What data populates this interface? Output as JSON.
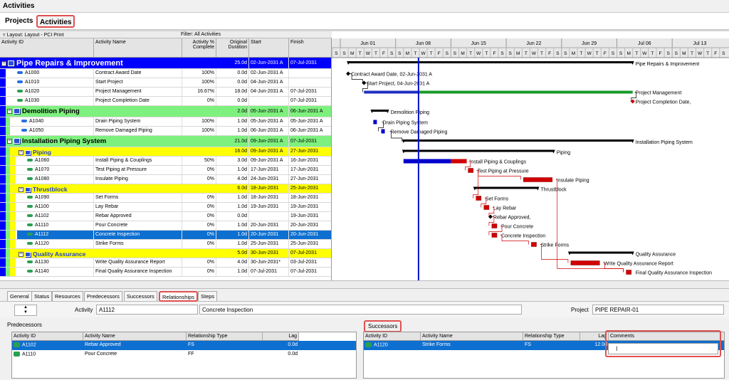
{
  "window_title": "Activities",
  "top_tabs": [
    {
      "label": "Projects"
    },
    {
      "label": "Activities"
    }
  ],
  "filter_bar": {
    "layout": "Layout: Layout - PCI Print",
    "filter": "Filter: All Activities"
  },
  "columns": [
    "Activity ID",
    "Activity Name",
    "Activity % Complete",
    "Original Duration",
    "Start",
    "Finish"
  ],
  "rows": [
    {
      "kind": "wbs1",
      "id": "",
      "name": "Pipe Repairs & Improvement",
      "pct": "",
      "dur": "25.0d",
      "start": "02-Jun-2031 A",
      "finish": "07-Jul-2031",
      "color": "#0000ff",
      "text_color": "#ffffff"
    },
    {
      "kind": "act",
      "id": "A1000",
      "name": "Contract Award Date",
      "pct": "100%",
      "dur": "0.0d",
      "start": "02-Jun-2031 A",
      "finish": "",
      "icon": "#2a6fe0"
    },
    {
      "kind": "act",
      "id": "A1010",
      "name": "Start Project",
      "pct": "100%",
      "dur": "0.0d",
      "start": "04-Jun-2031 A",
      "finish": "",
      "icon": "#2a6fe0"
    },
    {
      "kind": "act",
      "id": "A1020",
      "name": "Project Management",
      "pct": "16.67%",
      "dur": "18.0d",
      "start": "04-Jun-2031 A",
      "finish": "07-Jul-2031",
      "icon": "#2aa050"
    },
    {
      "kind": "act",
      "id": "A1030",
      "name": "Project Completion Date",
      "pct": "0%",
      "dur": "0.0d",
      "start": "",
      "finish": "07-Jul-2031",
      "icon": "#2aa050"
    },
    {
      "kind": "wbs1",
      "id": "",
      "name": "Demolition Piping",
      "pct": "",
      "dur": "2.0d",
      "start": "05-Jun-2031 A",
      "finish": "06-Jun-2031 A",
      "color": "#7ef07e",
      "text_color": "#000000"
    },
    {
      "kind": "act",
      "id": "A1040",
      "name": "Drain Piping System",
      "pct": "100%",
      "dur": "1.0d",
      "start": "05-Jun-2031 A",
      "finish": "05-Jun-2031 A",
      "icon": "#2a6fe0"
    },
    {
      "kind": "act",
      "id": "A1050",
      "name": "Remove Damaged Piping",
      "pct": "100%",
      "dur": "1.0d",
      "start": "06-Jun-2031 A",
      "finish": "06-Jun-2031 A",
      "icon": "#2a6fe0"
    },
    {
      "kind": "wbs1",
      "id": "",
      "name": "Installation Piping System",
      "pct": "",
      "dur": "21.0d",
      "start": "09-Jun-2031 A",
      "finish": "07-Jul-2031",
      "color": "#7ef07e",
      "text_color": "#000000"
    },
    {
      "kind": "wbs2",
      "id": "",
      "name": "Piping",
      "pct": "",
      "dur": "16.0d",
      "start": "09-Jun-2031 A",
      "finish": "27-Jun-2031",
      "color": "#ffff00",
      "text_color": "#000000"
    },
    {
      "kind": "act",
      "id": "A1060",
      "name": "Install Piping & Couplings",
      "pct": "50%",
      "dur": "3.0d",
      "start": "09-Jun-2031 A",
      "finish": "16-Jun-2031",
      "icon": "#2aa050"
    },
    {
      "kind": "act",
      "id": "A1070",
      "name": "Test Piping at Pressure",
      "pct": "0%",
      "dur": "1.0d",
      "start": "17-Jun-2031",
      "finish": "17-Jun-2031",
      "icon": "#2aa050"
    },
    {
      "kind": "act",
      "id": "A1080",
      "name": "Insulate Piping",
      "pct": "0%",
      "dur": "4.0d",
      "start": "24-Jun-2031",
      "finish": "27-Jun-2031",
      "icon": "#2aa050"
    },
    {
      "kind": "wbs2",
      "id": "",
      "name": "Thrustblock",
      "pct": "",
      "dur": "6.0d",
      "start": "18-Jun-2031",
      "finish": "25-Jun-2031",
      "color": "#ffff00",
      "text_color": "#000000"
    },
    {
      "kind": "act",
      "id": "A1090",
      "name": "Set Forms",
      "pct": "0%",
      "dur": "1.0d",
      "start": "18-Jun-2031",
      "finish": "18-Jun-2031",
      "icon": "#2aa050"
    },
    {
      "kind": "act",
      "id": "A1100",
      "name": "Lay Rebar",
      "pct": "0%",
      "dur": "1.0d",
      "start": "19-Jun-2031",
      "finish": "19-Jun-2031",
      "icon": "#2aa050"
    },
    {
      "kind": "act",
      "id": "A1102",
      "name": "Rebar Approved",
      "pct": "0%",
      "dur": "0.0d",
      "start": "",
      "finish": "19-Jun-2031",
      "icon": "#2aa050"
    },
    {
      "kind": "act",
      "id": "A1110",
      "name": "Pour Concrete",
      "pct": "0%",
      "dur": "1.0d",
      "start": "20-Jun-2031",
      "finish": "20-Jun-2031",
      "icon": "#2aa050"
    },
    {
      "kind": "act",
      "id": "A1112",
      "name": "Concrete Inspection",
      "pct": "0%",
      "dur": "1.0d",
      "start": "20-Jun-2031",
      "finish": "20-Jun-2031",
      "icon": "#2aa050",
      "selected": true
    },
    {
      "kind": "act",
      "id": "A1120",
      "name": "Strike Forms",
      "pct": "0%",
      "dur": "1.0d",
      "start": "25-Jun-2031",
      "finish": "25-Jun-2031",
      "icon": "#2aa050"
    },
    {
      "kind": "wbs2",
      "id": "",
      "name": "Quality Assurance",
      "pct": "",
      "dur": "5.0d",
      "start": "30-Jun-2031",
      "finish": "07-Jul-2031",
      "color": "#ffff00",
      "text_color": "#000000"
    },
    {
      "kind": "act",
      "id": "A1130",
      "name": "Write Quality Assurance Report",
      "pct": "0%",
      "dur": "4.0d",
      "start": "30-Jun-2031*",
      "finish": "03-Jul-2031",
      "icon": "#2aa050"
    },
    {
      "kind": "act",
      "id": "A1140",
      "name": "Final Quality Assurance Inspection",
      "pct": "0%",
      "dur": "1.0d",
      "start": "07-Jul-2031",
      "finish": "07-Jul-2031",
      "icon": "#2aa050"
    }
  ],
  "gantt": {
    "weeks": [
      "Jun 01",
      "Jun 08",
      "Jun 15",
      "Jun 22",
      "Jun 29",
      "Jul 06",
      "Jul 13"
    ],
    "day_letters": [
      "S",
      "M",
      "T",
      "W",
      "T",
      "F",
      "S"
    ],
    "data_date": "10-Jun-2031",
    "labels": [
      "Pipe Repairs & Improvement",
      "Contract Award Date, 02-Jun-2031 A",
      "Start Project, 04-Jun-2031 A",
      "Project Management",
      "Project Completion Date,",
      "Demolition Piping",
      "Drain Piping System",
      "Remove Damaged Piping",
      "Installation Piping System",
      "Piping",
      "Install Piping & Couplings",
      "Test Piping at Pressure",
      "Insulate Piping",
      "Thrustblock",
      "Set Forms",
      "Lay Rebar",
      "Rebar Approved,",
      "Pour Concrete",
      "Concrete Inspection",
      "Strike Forms",
      "Quality Assurance",
      "Write Quality Assurance Report",
      "Final Quality Assurance Inspection"
    ]
  },
  "bottom_tabs": [
    "General",
    "Status",
    "Resources",
    "Predecessors",
    "Successors",
    "Relationships",
    "Steps"
  ],
  "active_bottom_tab": "Relationships",
  "detail": {
    "activity_label": "Activity",
    "activity_id": "A1112",
    "activity_name": "Concrete Inspection",
    "project_label": "Project",
    "project_value": "PIPE REPAIR-01"
  },
  "predecessors": {
    "title": "Predecessors",
    "columns": [
      "Activity ID",
      "Activity Name",
      "Relationship Type",
      "Lag"
    ],
    "rows": [
      {
        "id": "A1102",
        "name": "Rebar Approved",
        "type": "FS",
        "lag": "0.0d",
        "selected": true
      },
      {
        "id": "A1110",
        "name": "Pour Concrete",
        "type": "FF",
        "lag": "0.0d",
        "selected": false
      }
    ]
  },
  "successors": {
    "title": "Successors",
    "columns": [
      "Activity ID",
      "Activity Name",
      "Relationship Type",
      "Lag",
      "Comments"
    ],
    "rows": [
      {
        "id": "A1120",
        "name": "Strike Forms",
        "type": "FS",
        "lag": "12.0d",
        "comments": "",
        "selected": true
      }
    ]
  }
}
